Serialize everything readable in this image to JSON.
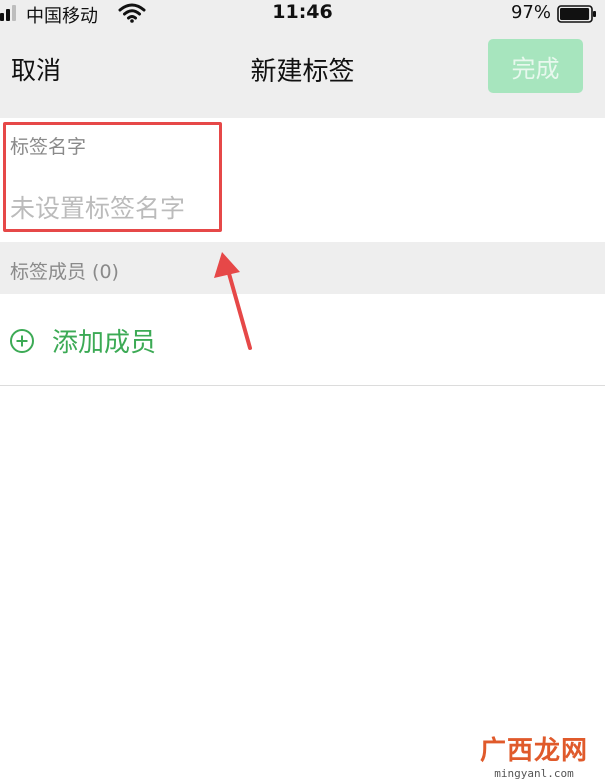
{
  "status_bar": {
    "carrier": "中国移动",
    "time": "11:46",
    "battery_percent": "97%",
    "battery_level": 0.97,
    "signal_bars_filled": 2
  },
  "nav": {
    "cancel_label": "取消",
    "title": "新建标签",
    "done_label": "完成"
  },
  "tag_name": {
    "section_label": "标签名字",
    "input_value": "",
    "input_placeholder": "未设置标签名字"
  },
  "members": {
    "section_label": "标签成员 (0)",
    "add_member_label": "添加成员"
  },
  "watermark": {
    "main": "广西龙网",
    "sub": "mingyanl.com"
  },
  "colors": {
    "accent_green": "#3caa55",
    "done_disabled_bg": "#a7e5be",
    "highlight_red": "#e64848",
    "background_gray": "#eeeeee"
  }
}
